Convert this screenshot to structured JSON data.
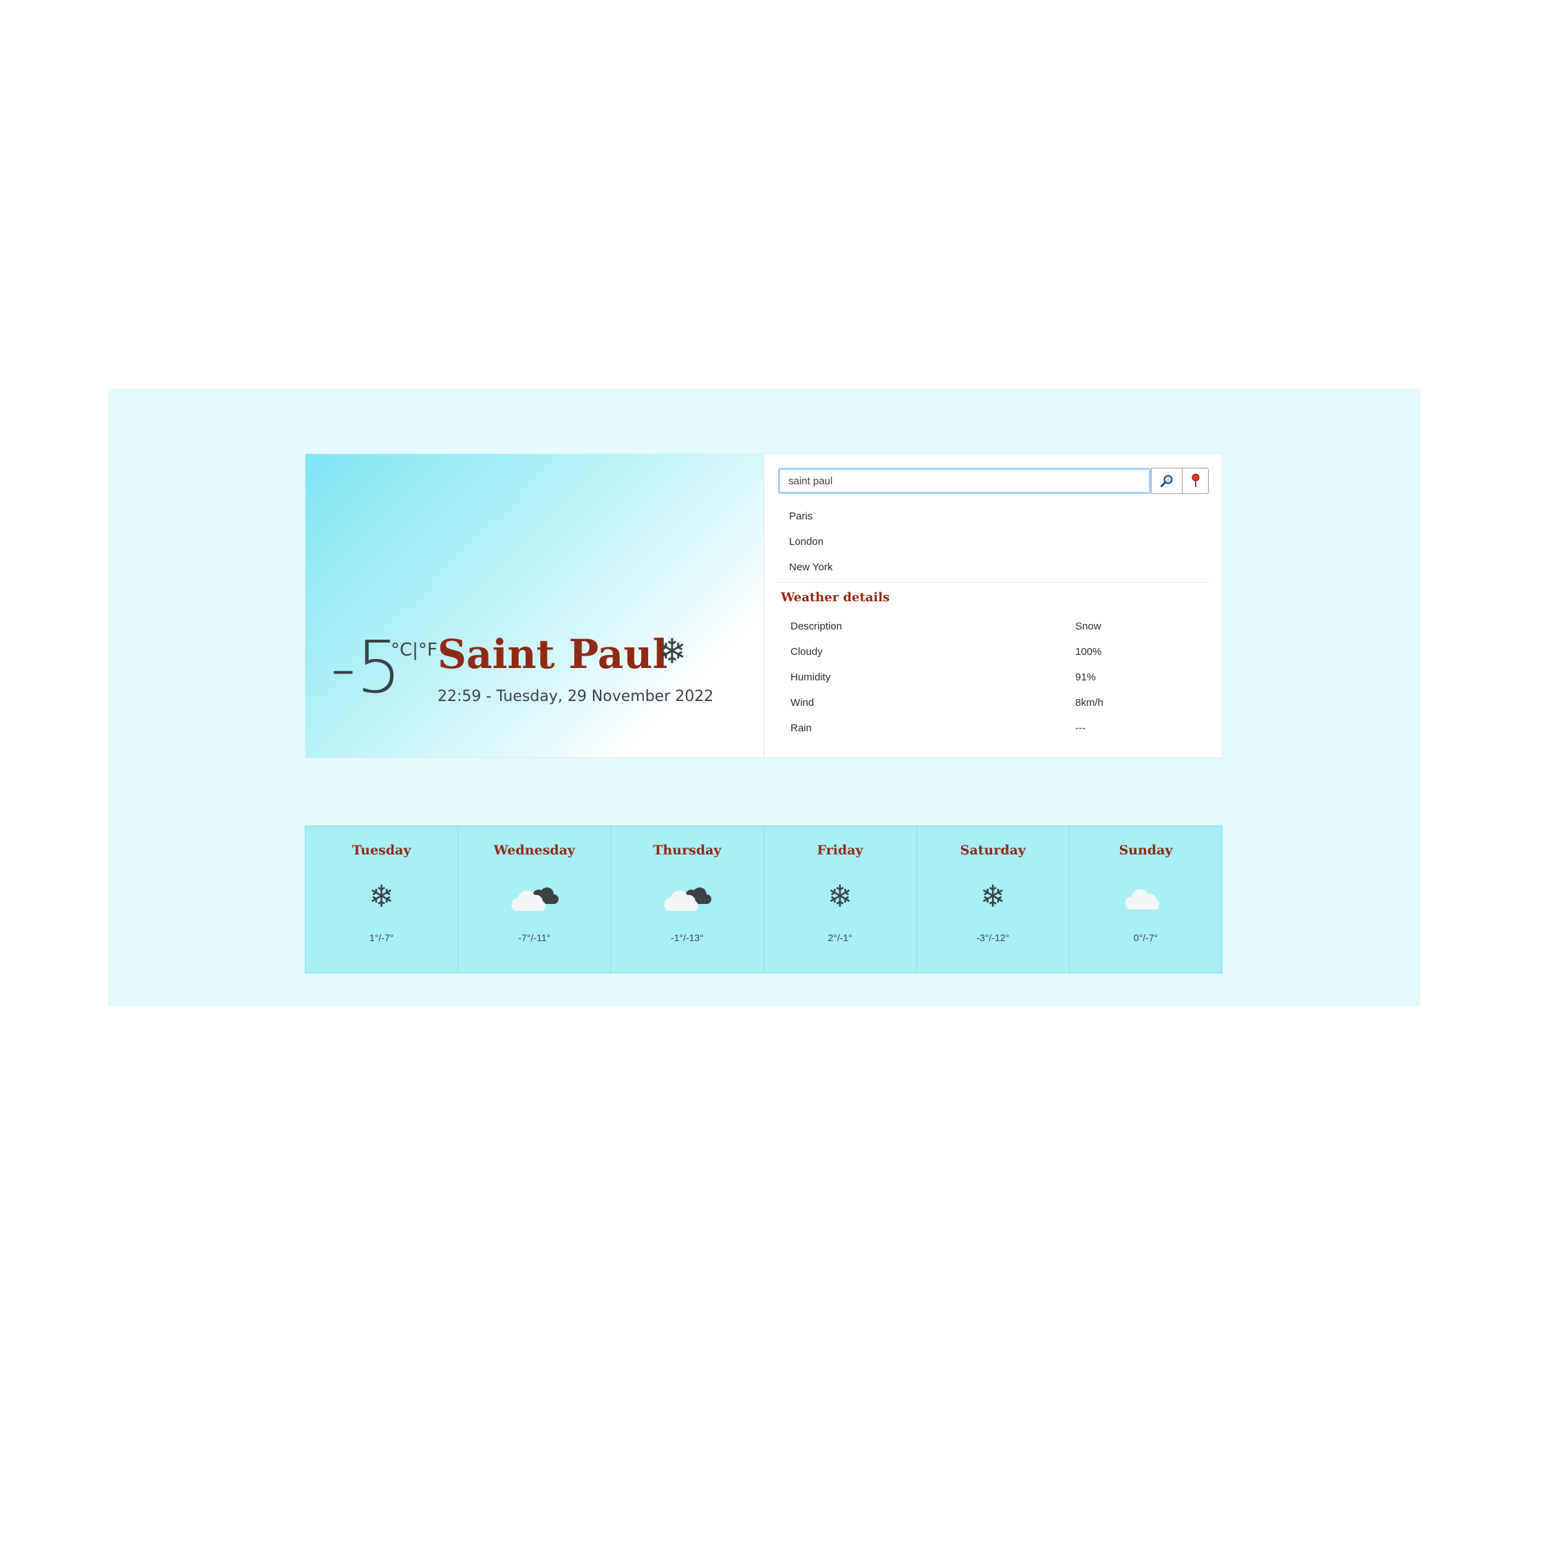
{
  "current": {
    "temperature": "-5",
    "unit_c": "°C",
    "unit_sep": "|",
    "unit_f": "°F",
    "city": "Saint Paul",
    "datetime": "22:59 - Tuesday, 29 November 2022",
    "icon": "snowflake-icon"
  },
  "search": {
    "value": "saint paul",
    "suggestions": [
      "Paris",
      "London",
      "New York"
    ]
  },
  "details": {
    "title": "Weather details",
    "rows": [
      {
        "label": "Description",
        "value": "Snow"
      },
      {
        "label": "Cloudy",
        "value": "100%"
      },
      {
        "label": "Humidity",
        "value": "91%"
      },
      {
        "label": "Wind",
        "value": "8km/h"
      },
      {
        "label": "Rain",
        "value": "---"
      }
    ]
  },
  "forecast": [
    {
      "day": "Tuesday",
      "icon": "snowflake-icon",
      "temps": "1°/-7°"
    },
    {
      "day": "Wednesday",
      "icon": "cloudy-icon",
      "temps": "-7°/-11°"
    },
    {
      "day": "Thursday",
      "icon": "cloudy-icon",
      "temps": "-1°/-13°"
    },
    {
      "day": "Friday",
      "icon": "snowflake-icon",
      "temps": "2°/-1°"
    },
    {
      "day": "Saturday",
      "icon": "snowflake-icon",
      "temps": "-3°/-12°"
    },
    {
      "day": "Sunday",
      "icon": "cloud-icon",
      "temps": "0°/-7°"
    }
  ],
  "colors": {
    "background": "#e4fafc",
    "accent": "#8f2a14",
    "forecast_bg": "#a8eff6",
    "text": "#3d4247"
  }
}
